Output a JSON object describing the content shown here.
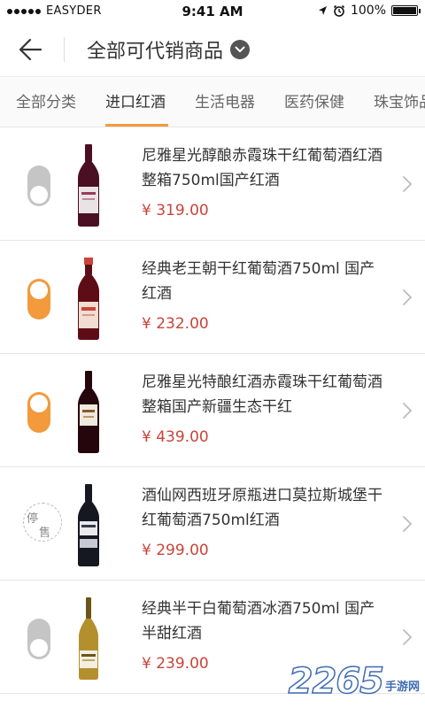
{
  "status_bar": {
    "carrier": "EASYDER",
    "time": "9:41 AM",
    "battery": "100%",
    "battery_level": 1.0
  },
  "nav": {
    "title": "全部可代销商品"
  },
  "tabs": [
    {
      "label": "全部分类",
      "active": false
    },
    {
      "label": "进口红酒",
      "active": true
    },
    {
      "label": "生活电器",
      "active": false
    },
    {
      "label": "医药保健",
      "active": false
    },
    {
      "label": "珠宝饰品",
      "active": false
    }
  ],
  "products": [
    {
      "title": "尼雅星光醇酿赤霞珠干红葡萄酒红酒整箱750ml国产红酒",
      "price": "¥ 319.00",
      "status": "off",
      "bottle_color": "#4a0f22",
      "label_color": "#e9e3e6"
    },
    {
      "title": "经典老王朝干红葡萄酒750ml 国产红酒",
      "price": "¥ 232.00",
      "status": "on",
      "bottle_color": "#5e0d16",
      "label_color": "#f1ddd2"
    },
    {
      "title": "尼雅星光特酿红酒赤霞珠干红葡萄酒整箱国产新疆生态干红",
      "price": "¥ 439.00",
      "status": "on",
      "bottle_color": "#24060c",
      "label_color": "#f0e9de"
    },
    {
      "title": "酒仙网西班牙原瓶进口莫拉斯城堡干红葡萄酒750ml红酒",
      "price": "¥ 299.00",
      "status": "stopped",
      "stamp_text": [
        "停",
        "售"
      ],
      "bottle_color": "#151821",
      "label_color": "#e9e9ee"
    },
    {
      "title": "经典半干白葡萄酒冰酒750ml 国产半甜红酒",
      "price": "¥ 239.00",
      "status": "off",
      "bottle_color": "#b48f2e",
      "label_color": "#f3eee0"
    }
  ],
  "watermark": {
    "number": "2265",
    "text": "手游网"
  },
  "colors": {
    "accent": "#f29a3c",
    "price": "#c9443a",
    "toggle_off": "#c5c5c5"
  },
  "icons": {
    "back": "back-arrow-icon",
    "dropdown": "chevron-down-icon",
    "row_chevron": "chevron-right-icon",
    "alarm": "alarm-icon",
    "location": "location-arrow-icon"
  }
}
